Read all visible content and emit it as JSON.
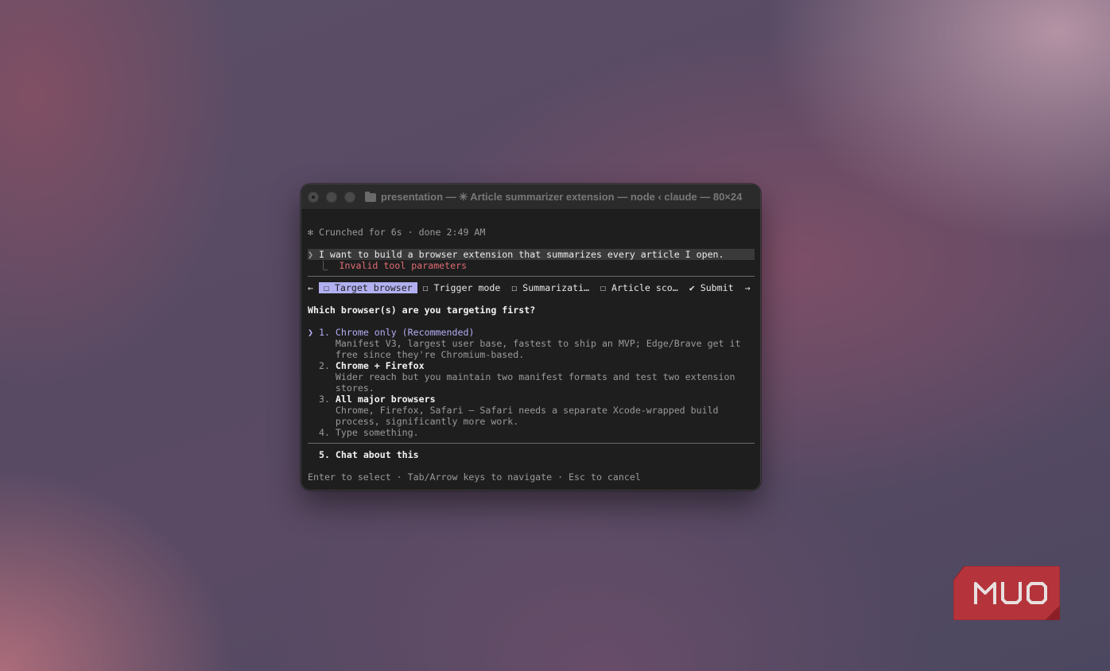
{
  "window": {
    "title": "presentation — ✳ Article summarizer extension — node ‹ claude — 80×24"
  },
  "terminal": {
    "status": "✻ Crunched for 6s · done 2:49 AM",
    "prompt_marker": "❯",
    "prompt": "I want to build a browser extension that summarizes every article I open.",
    "error_marker": "⎿",
    "error": "Invalid tool parameters",
    "tabs": {
      "prev_arrow": "←",
      "next_arrow": "→",
      "items": [
        {
          "label": "☐ Target browser"
        },
        {
          "label": "☐ Trigger mode"
        },
        {
          "label": "☐ Summarizati…"
        },
        {
          "label": "☐ Article sco…"
        },
        {
          "label": "✔ Submit"
        }
      ]
    },
    "question": "Which browser(s) are you targeting first?",
    "cursor": "❯",
    "options": [
      {
        "num": "1.",
        "label": "Chrome only (Recommended)",
        "desc": [
          "Manifest V3, largest user base, fastest to ship an MVP; Edge/Brave get it",
          "free since they're Chromium-based."
        ]
      },
      {
        "num": "2.",
        "label": "Chrome + Firefox",
        "desc": [
          "Wider reach but you maintain two manifest formats and test two extension",
          "stores."
        ]
      },
      {
        "num": "3.",
        "label": "All major browsers",
        "desc": [
          "Chrome, Firefox, Safari — Safari needs a separate Xcode-wrapped build",
          "process, significantly more work."
        ]
      },
      {
        "num": "4.",
        "label": "Type something.",
        "desc": []
      }
    ],
    "chat_option": {
      "num": "5.",
      "label": "Chat about this"
    },
    "footer": "Enter to select · Tab/Arrow keys to navigate · Esc to cancel"
  },
  "logo": {
    "text": "MUO",
    "color": "#b5343b"
  }
}
